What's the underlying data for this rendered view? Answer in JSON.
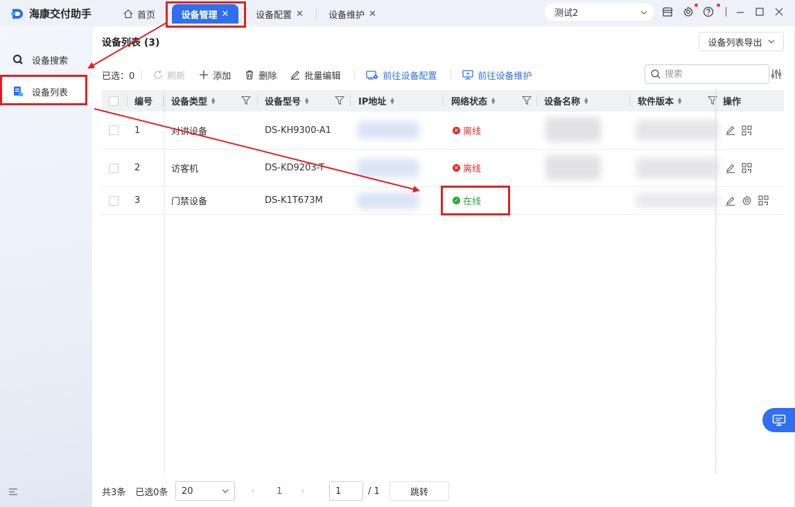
{
  "app": {
    "title": "海康交付助手"
  },
  "tabs": [
    {
      "label": "首页"
    },
    {
      "label": "设备管理"
    },
    {
      "label": "设备配置"
    },
    {
      "label": "设备维护"
    }
  ],
  "account": {
    "name": "测试2"
  },
  "sidebar": {
    "items": [
      {
        "label": "设备搜索"
      },
      {
        "label": "设备列表"
      }
    ]
  },
  "panel": {
    "title": "设备列表 (3)",
    "export_label": "设备列表导出"
  },
  "toolbar": {
    "selected_label": "已选：0",
    "refresh": "刷新",
    "add": "添加",
    "delete": "删除",
    "batch_edit": "批量编辑",
    "goto_config": "前往设备配置",
    "goto_maint": "前往设备维护",
    "search_placeholder": "搜索"
  },
  "table": {
    "columns": [
      "编号",
      "设备类型",
      "设备型号",
      "IP地址",
      "网络状态",
      "设备名称",
      "软件版本",
      "操作"
    ],
    "rows": [
      {
        "num": "1",
        "type": "对讲设备",
        "model": "DS-KH9300-A1",
        "status": "离线"
      },
      {
        "num": "2",
        "type": "访客机",
        "model": "DS-KD9203-T",
        "status": "离线"
      },
      {
        "num": "3",
        "type": "门禁设备",
        "model": "DS-K1T673M",
        "status": "在线"
      }
    ]
  },
  "footer": {
    "total": "共3条",
    "selected": "已选0条",
    "page_size": "20",
    "current_page": "1",
    "page_input": "1",
    "page_total": "/ 1",
    "jump": "跳转"
  },
  "colors": {
    "accent": "#2f6ff0",
    "offline": "#e0302c",
    "online": "#23a83a",
    "annotation": "#e02020"
  }
}
